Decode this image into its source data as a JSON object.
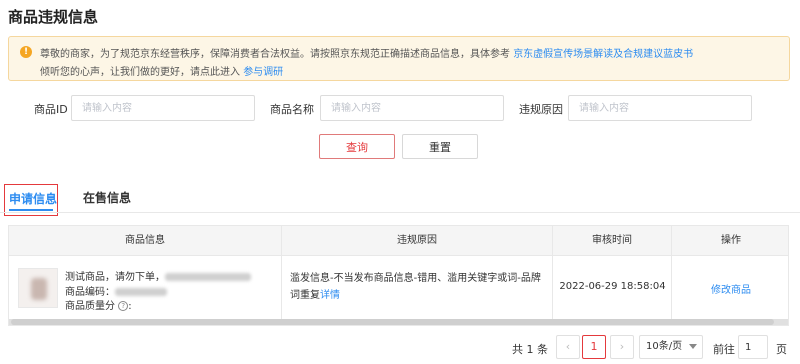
{
  "page": {
    "title": "商品违规信息"
  },
  "notice": {
    "icon": "warning-icon",
    "line1_text": "尊敬的商家，为了规范京东经营秩序，保障消费者合法权益。请按照京东规范正确描述商品信息，具体参考",
    "line1_link": "京东虚假宣传场景解读及合规建议蓝皮书",
    "line2_text": "倾听您的心声，让我们做的更好，请点此进入",
    "line2_link": "参与调研"
  },
  "filters": {
    "product_id": {
      "label": "商品ID",
      "placeholder": "请输入内容",
      "value": ""
    },
    "product_name": {
      "label": "商品名称",
      "placeholder": "请输入内容",
      "value": ""
    },
    "violation_reason": {
      "label": "违规原因",
      "placeholder": "请输入内容",
      "value": ""
    },
    "query_label": "查询",
    "reset_label": "重置"
  },
  "tabs": [
    {
      "label": "申请信息",
      "active": true
    },
    {
      "label": "在售信息",
      "active": false
    }
  ],
  "table": {
    "headers": [
      "商品信息",
      "违规原因",
      "审核时间",
      "操作"
    ],
    "rows": [
      {
        "product_name_prefix": "测试商品，请勿下单，",
        "product_code_label": "商品编码：",
        "quality_label": "商品质量分",
        "reason_text": "滥发信息-不当发布商品信息-错用、滥用关键字或词-品牌词重复",
        "reason_link": "详情",
        "time": "2022-06-29 18:58:04",
        "action": "修改商品"
      }
    ]
  },
  "pagination": {
    "total_text": "共 1 条",
    "current_page": "1",
    "page_size": "10条/页",
    "goto_label": "前往",
    "goto_value": "1",
    "unit": "页"
  },
  "colors": {
    "accent": "#2d8cf0",
    "brand_red": "#e4393c",
    "notice_bg": "#fdf6e6"
  }
}
